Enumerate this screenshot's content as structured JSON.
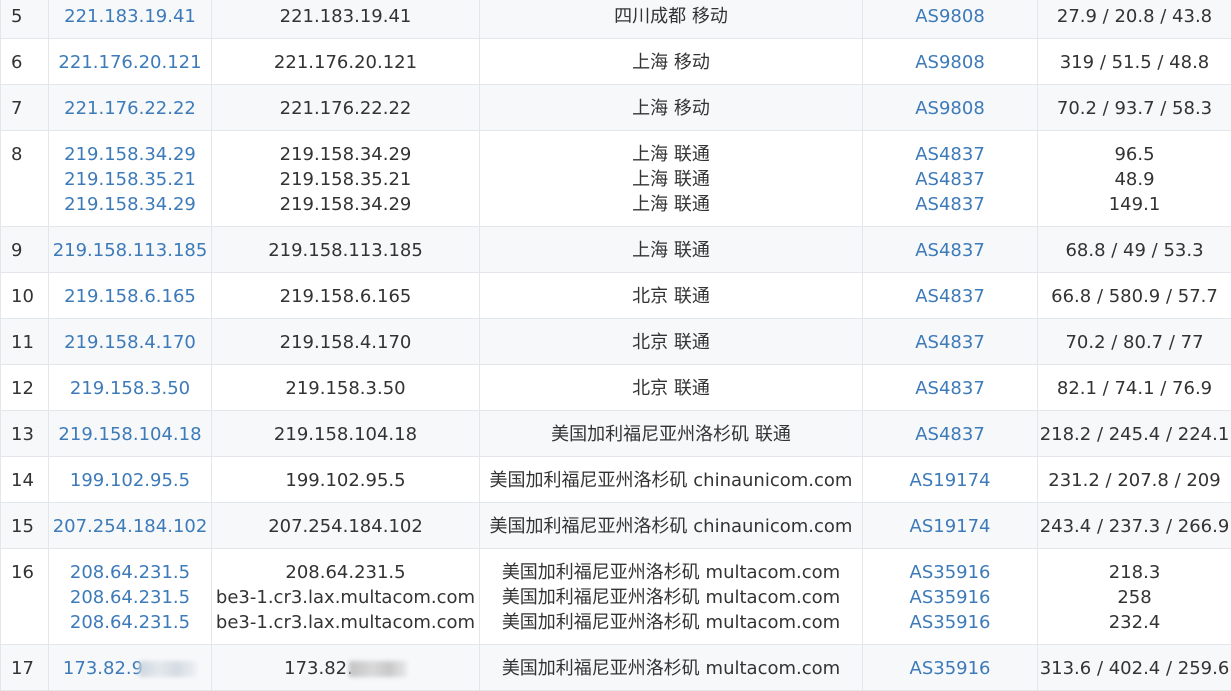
{
  "rows": [
    {
      "hop": "5",
      "ip": [
        "221.183.19.41"
      ],
      "host": [
        "221.183.19.41"
      ],
      "geo": [
        "四川成都 移动"
      ],
      "asn": [
        "AS9808"
      ],
      "rtt": [
        "27.9 / 20.8 / 43.8"
      ]
    },
    {
      "hop": "6",
      "ip": [
        "221.176.20.121"
      ],
      "host": [
        "221.176.20.121"
      ],
      "geo": [
        "上海 移动"
      ],
      "asn": [
        "AS9808"
      ],
      "rtt": [
        "319 / 51.5 / 48.8"
      ]
    },
    {
      "hop": "7",
      "ip": [
        "221.176.22.22"
      ],
      "host": [
        "221.176.22.22"
      ],
      "geo": [
        "上海 移动"
      ],
      "asn": [
        "AS9808"
      ],
      "rtt": [
        "70.2 / 93.7 / 58.3"
      ]
    },
    {
      "hop": "8",
      "ip": [
        "219.158.34.29",
        "219.158.35.21",
        "219.158.34.29"
      ],
      "host": [
        "219.158.34.29",
        "219.158.35.21",
        "219.158.34.29"
      ],
      "geo": [
        "上海 联通",
        "上海 联通",
        "上海 联通"
      ],
      "asn": [
        "AS4837",
        "AS4837",
        "AS4837"
      ],
      "rtt": [
        "96.5",
        "48.9",
        "149.1"
      ]
    },
    {
      "hop": "9",
      "ip": [
        "219.158.113.185"
      ],
      "host": [
        "219.158.113.185"
      ],
      "geo": [
        "上海 联通"
      ],
      "asn": [
        "AS4837"
      ],
      "rtt": [
        "68.8 / 49 / 53.3"
      ]
    },
    {
      "hop": "10",
      "ip": [
        "219.158.6.165"
      ],
      "host": [
        "219.158.6.165"
      ],
      "geo": [
        "北京 联通"
      ],
      "asn": [
        "AS4837"
      ],
      "rtt": [
        "66.8 / 580.9 / 57.7"
      ]
    },
    {
      "hop": "11",
      "ip": [
        "219.158.4.170"
      ],
      "host": [
        "219.158.4.170"
      ],
      "geo": [
        "北京 联通"
      ],
      "asn": [
        "AS4837"
      ],
      "rtt": [
        "70.2 / 80.7 / 77"
      ]
    },
    {
      "hop": "12",
      "ip": [
        "219.158.3.50"
      ],
      "host": [
        "219.158.3.50"
      ],
      "geo": [
        "北京 联通"
      ],
      "asn": [
        "AS4837"
      ],
      "rtt": [
        "82.1 / 74.1 / 76.9"
      ]
    },
    {
      "hop": "13",
      "ip": [
        "219.158.104.18"
      ],
      "host": [
        "219.158.104.18"
      ],
      "geo": [
        "美国加利福尼亚州洛杉矶 联通"
      ],
      "asn": [
        "AS4837"
      ],
      "rtt": [
        "218.2 / 245.4 / 224.1"
      ]
    },
    {
      "hop": "14",
      "ip": [
        "199.102.95.5"
      ],
      "host": [
        "199.102.95.5"
      ],
      "geo": [
        "美国加利福尼亚州洛杉矶 chinaunicom.com"
      ],
      "asn": [
        "AS19174"
      ],
      "rtt": [
        "231.2 / 207.8 / 209"
      ]
    },
    {
      "hop": "15",
      "ip": [
        "207.254.184.102"
      ],
      "host": [
        "207.254.184.102"
      ],
      "geo": [
        "美国加利福尼亚州洛杉矶 chinaunicom.com"
      ],
      "asn": [
        "AS19174"
      ],
      "rtt": [
        "243.4 / 237.3 / 266.9"
      ]
    },
    {
      "hop": "16",
      "ip": [
        "208.64.231.5",
        "208.64.231.5",
        "208.64.231.5"
      ],
      "host": [
        "208.64.231.5",
        "be3-1.cr3.lax.multacom.com",
        "be3-1.cr3.lax.multacom.com"
      ],
      "geo": [
        "美国加利福尼亚州洛杉矶 multacom.com",
        "美国加利福尼亚州洛杉矶 multacom.com",
        "美国加利福尼亚州洛杉矶 multacom.com"
      ],
      "asn": [
        "AS35916",
        "AS35916",
        "AS35916"
      ],
      "rtt": [
        "218.3",
        "258",
        "232.4"
      ]
    },
    {
      "hop": "17",
      "ip": [
        "173.82.9"
      ],
      "host": [
        "173.82."
      ],
      "geo": [
        "美国加利福尼亚州洛杉矶 multacom.com"
      ],
      "asn": [
        "AS35916"
      ],
      "rtt": [
        "313.6 / 402.4 / 259.6"
      ],
      "redacted": true
    }
  ]
}
